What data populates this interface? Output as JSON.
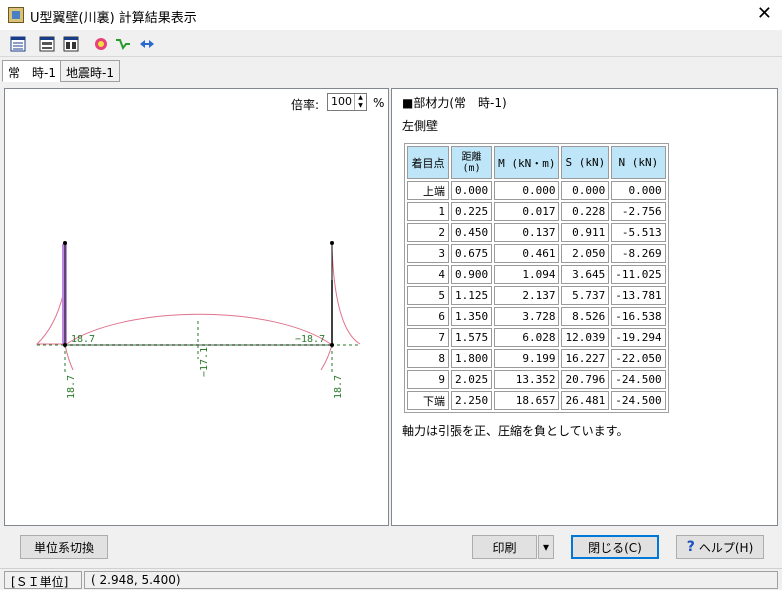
{
  "window": {
    "title": "U型翼壁(川裏) 計算結果表示",
    "close_glyph": "✕"
  },
  "toolbar": {
    "buttons": [
      {
        "icon": "table-view-icon"
      },
      {
        "icon": "print-preview-icon"
      },
      {
        "icon": "layout-icon"
      },
      {
        "icon": "refresh-icon"
      },
      {
        "icon": "zigzag-icon"
      },
      {
        "icon": "arrows-icon"
      }
    ]
  },
  "tabs": [
    {
      "label": "常　時-1",
      "active": true
    },
    {
      "label": "地震時-1",
      "active": false
    }
  ],
  "zoom": {
    "label": "倍率:",
    "value": "100",
    "unit": "%"
  },
  "diagram": {
    "labels": {
      "left_top": "18.7",
      "right_top": "−18.7",
      "center": "−17.1",
      "left_bottom": "18.7",
      "right_bottom": "18.7"
    },
    "colors": {
      "wall": "#c08ae0",
      "curve": "#e0728c",
      "dim": "#2a7a2a",
      "member": "#000000"
    }
  },
  "result": {
    "title": "■部材力(常　時-1)",
    "subtitle": "左側壁",
    "headers": [
      "着目点",
      "距離",
      "(m)",
      "M (kN・m)",
      "S (kN)",
      "N (kN)"
    ],
    "rows": [
      [
        "上端",
        "0.000",
        "0.000",
        "0.000",
        "0.000"
      ],
      [
        "1",
        "0.225",
        "0.017",
        "0.228",
        "-2.756"
      ],
      [
        "2",
        "0.450",
        "0.137",
        "0.911",
        "-5.513"
      ],
      [
        "3",
        "0.675",
        "0.461",
        "2.050",
        "-8.269"
      ],
      [
        "4",
        "0.900",
        "1.094",
        "3.645",
        "-11.025"
      ],
      [
        "5",
        "1.125",
        "2.137",
        "5.737",
        "-13.781"
      ],
      [
        "6",
        "1.350",
        "3.728",
        "8.526",
        "-16.538"
      ],
      [
        "7",
        "1.575",
        "6.028",
        "12.039",
        "-19.294"
      ],
      [
        "8",
        "1.800",
        "9.199",
        "16.227",
        "-22.050"
      ],
      [
        "9",
        "2.025",
        "13.352",
        "20.796",
        "-24.500"
      ],
      [
        "下端",
        "2.250",
        "18.657",
        "26.481",
        "-24.500"
      ]
    ],
    "note": "軸力は引張を正、圧縮を負としています。"
  },
  "buttons": {
    "unit_switch": "単位系切換",
    "print": "印刷",
    "print_dropdown": "▾",
    "close": "閉じる(C)",
    "help": "ヘルプ(H)",
    "help_glyph": "?"
  },
  "status": {
    "unit": "[ＳＩ単位]",
    "coords": "(  2.948,  5.400)"
  }
}
